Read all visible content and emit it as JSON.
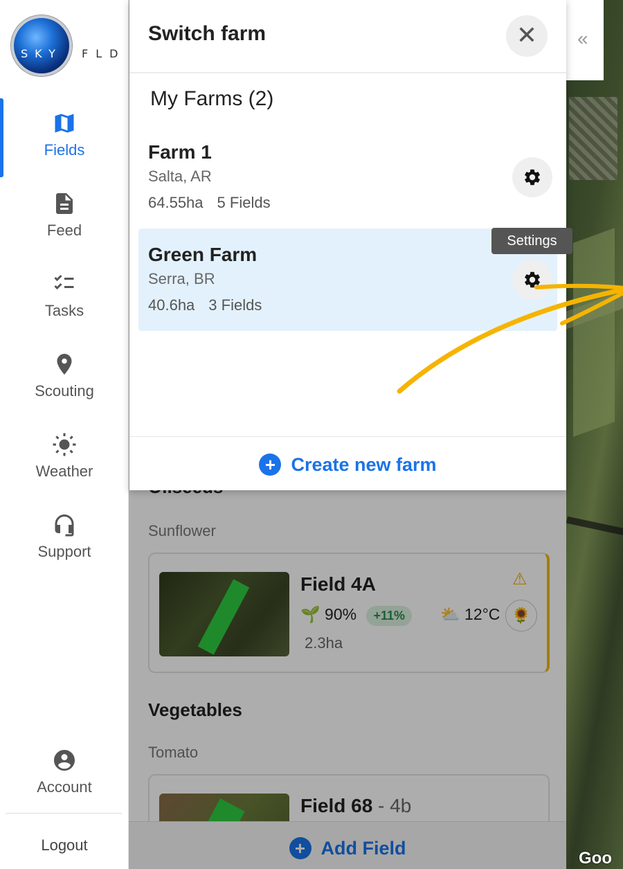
{
  "app": {
    "logo_left": "SKY",
    "logo_right": "FLD"
  },
  "sidebar": {
    "items": [
      {
        "label": "Fields",
        "icon": "map-icon",
        "active": true
      },
      {
        "label": "Feed",
        "icon": "document-icon"
      },
      {
        "label": "Tasks",
        "icon": "checklist-icon"
      },
      {
        "label": "Scouting",
        "icon": "location-pin-icon"
      },
      {
        "label": "Weather",
        "icon": "sun-icon"
      },
      {
        "label": "Support",
        "icon": "headset-icon"
      }
    ],
    "account_label": "Account",
    "logout_label": "Logout"
  },
  "modal": {
    "title": "Switch farm",
    "section_title": "My Farms (2)",
    "farms": [
      {
        "name": "Farm 1",
        "location": "Salta, AR",
        "area": "64.55ha",
        "fields": "5 Fields",
        "selected": false
      },
      {
        "name": "Green Farm",
        "location": "Serra, BR",
        "area": "40.6ha",
        "fields": "3 Fields",
        "selected": true
      }
    ],
    "tooltip": "Settings",
    "create_label": "Create new farm"
  },
  "list": {
    "group_oilseeds": "Oilseeds",
    "crop_sunflower": "Sunflower",
    "field_4a": {
      "title": "Field 4A",
      "health": "90%",
      "change": "+11%",
      "temperature": "12°C",
      "area": "2.3ha"
    },
    "group_vegetables": "Vegetables",
    "crop_tomato": "Tomato",
    "field_68": {
      "title": "Field 68",
      "suffix": " - 4b"
    },
    "add_field_label": "Add Field"
  },
  "map": {
    "attribution": "Goo"
  },
  "colors": {
    "accent": "#1a73e8",
    "selected_farm_bg": "#e3f1fc",
    "arrow": "#f5b400",
    "warning": "#f0a800"
  }
}
